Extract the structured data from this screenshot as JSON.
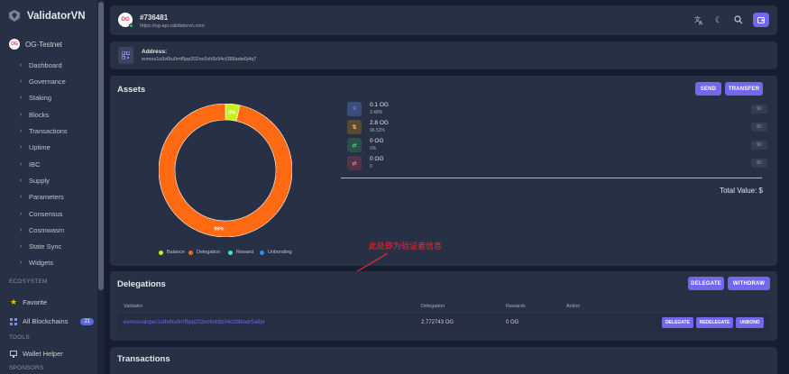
{
  "brand": {
    "name": "ValidatorVN"
  },
  "chain": {
    "name": "OG-Testnet",
    "avatar_text": "OG"
  },
  "nav": [
    {
      "label": "Dashboard"
    },
    {
      "label": "Governance"
    },
    {
      "label": "Staking"
    },
    {
      "label": "Blocks"
    },
    {
      "label": "Transactions"
    },
    {
      "label": "Uptime"
    },
    {
      "label": "IBC"
    },
    {
      "label": "Supply"
    },
    {
      "label": "Parameters"
    },
    {
      "label": "Consensus"
    },
    {
      "label": "Cosmwasm"
    },
    {
      "label": "State Sync"
    },
    {
      "label": "Widgets"
    }
  ],
  "sections": {
    "ecosystem": "ECOSYSTEM",
    "tools": "TOOLS",
    "sponsors": "SPONSORS"
  },
  "favorite": {
    "label": "Favorite"
  },
  "all_blockchains": {
    "label": "All Blockchains",
    "count": "21"
  },
  "wallet_helper": {
    "label": "Wallet Helper"
  },
  "header": {
    "title": "#736481",
    "subtitle": "https://og-api.validatorvn.com",
    "avatar_text": "OG"
  },
  "address": {
    "label": "Address:",
    "value": "evmos1u9v6tu0rnf5pp202nc6xh8z94ct388adw6j4q7"
  },
  "assets": {
    "title": "Assets",
    "send_label": "SEND",
    "transfer_label": "TRANSFER",
    "items": [
      {
        "amount": "0.1 OG",
        "percent": "3.48%",
        "usd": "$0",
        "color": "#7367f0"
      },
      {
        "amount": "2.8 OG",
        "percent": "96.52%",
        "usd": "$0",
        "color": "#ff9f43"
      },
      {
        "amount": "0 OG",
        "percent": "0%",
        "usd": "$0",
        "color": "#28c76f"
      },
      {
        "amount": "0 OG",
        "percent": "0",
        "usd": "$0",
        "color": "#ea5455"
      }
    ],
    "total_label": "Total Value: $"
  },
  "chart_data": {
    "type": "pie",
    "categories": [
      "Balance",
      "Delegation",
      "Reward",
      "Unbonding"
    ],
    "values": [
      3.48,
      96.52,
      0,
      0
    ],
    "data_labels": [
      "3%",
      "96%"
    ],
    "colors": [
      "#c6f01f",
      "#ff6a13",
      "#37e6d6",
      "#2f8fe8"
    ],
    "legend_placement": "bottom"
  },
  "annotation": {
    "text": "此处即为验证者信息"
  },
  "delegations": {
    "title": "Delegations",
    "delegate_label": "DELEGATE",
    "withdraw_label": "WITHDRAW",
    "columns": [
      "Validator",
      "Delegation",
      "Rewards",
      "Action"
    ],
    "rows": [
      {
        "validator": "evmosvaloper1u9v6tu0rnf5pp202nc6xh8z94ct388adr5a9pr",
        "delegation": "2.772743 OG",
        "rewards": "0 OG",
        "actions": [
          "DELEGATE",
          "REDELEGATE",
          "UNBOND"
        ]
      }
    ]
  },
  "transactions": {
    "title": "Transactions"
  }
}
